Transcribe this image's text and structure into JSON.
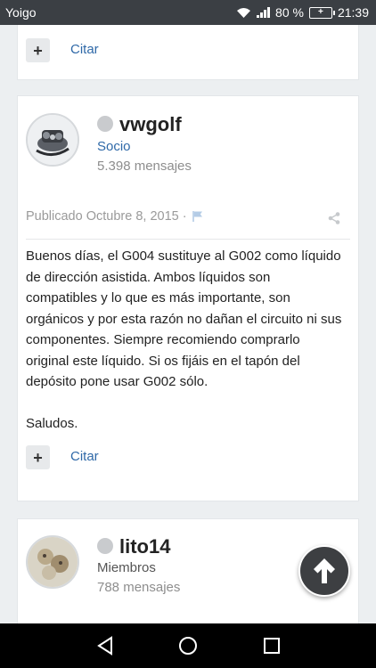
{
  "status_bar": {
    "carrier": "Yoigo",
    "battery_percent": "80 %",
    "time": "21:39"
  },
  "previous_post": {
    "plus_label": "+",
    "quote_label": "Citar"
  },
  "post": {
    "username": "vwgolf",
    "role": "Socio",
    "role_color": "#2f69a8",
    "post_count": "5.398 mensajes",
    "published": "Publicado Octubre 8, 2015 ·",
    "paragraphs": [
      "Buenos días, el G004 sustituye al G002 como líquido de dirección asistida. Ambos líquidos son compatibles y lo que es más importante, son orgánicos y por esta razón no dañan el circuito ni sus componentes. Siempre recomiendo comprarlo original este líquido. Si os fijáis en el tapón del depósito pone usar G002 sólo.",
      "Saludos."
    ],
    "plus_label": "+",
    "quote_label": "Citar"
  },
  "next_post": {
    "username": "lito14",
    "role": "Miembros",
    "post_count": "788 mensajes"
  },
  "icons": {
    "flag": "flag-icon",
    "share": "share-icon",
    "scroll_top": "arrow-up-icon",
    "nav_back": "back-triangle-icon",
    "nav_home": "home-circle-icon",
    "nav_recent": "recent-square-icon"
  }
}
